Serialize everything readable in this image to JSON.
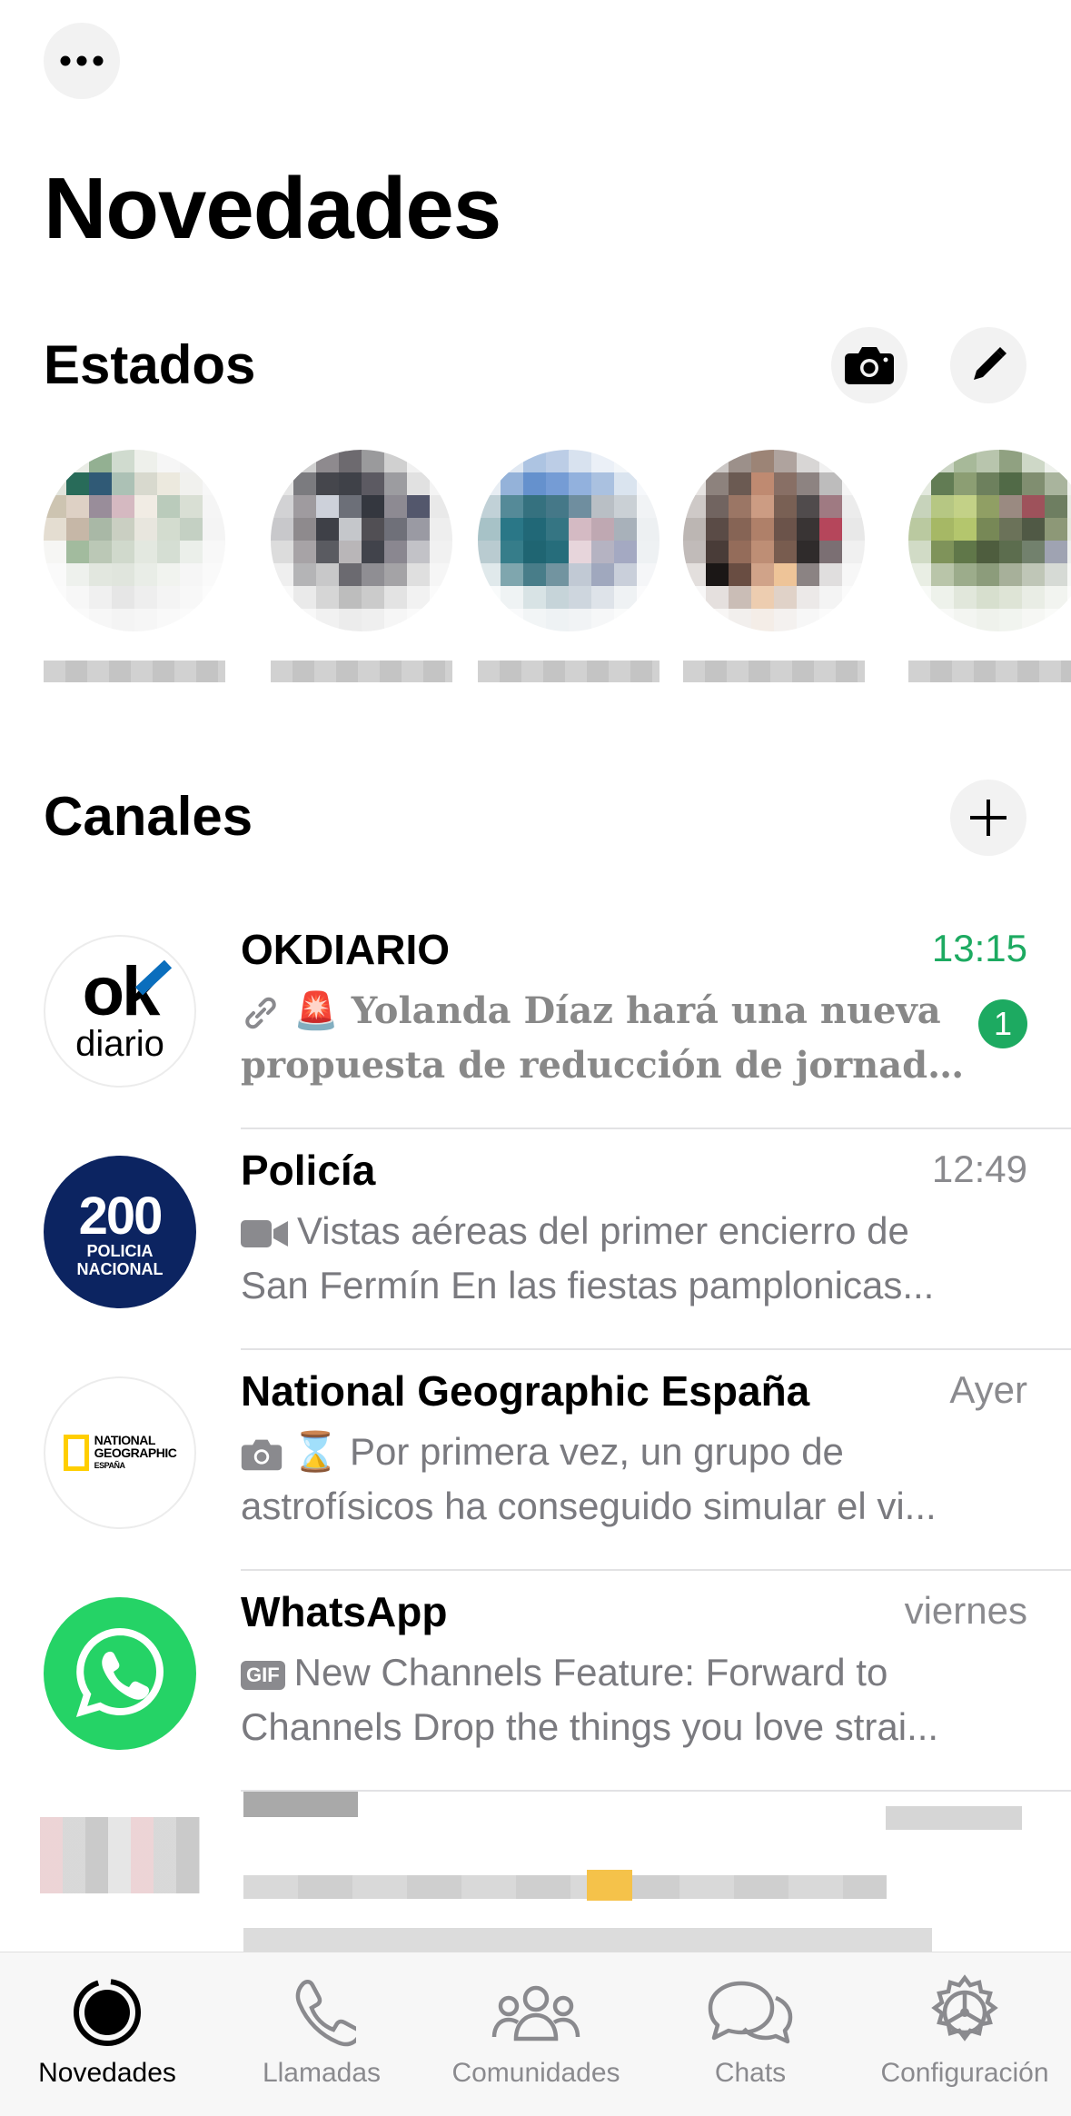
{
  "header": {
    "title": "Novedades"
  },
  "statuses": {
    "title": "Estados",
    "avatars": [
      {
        "colors": [
          "#f4f4f2",
          "#e9ece4",
          "#8fb28e",
          "#cfdccd",
          "#eef0ea",
          "#f6f6f6",
          "#f2f2f2",
          "#f8f8f8",
          "#e2e4db",
          "#1f6e58",
          "#2a5b7c",
          "#a9c2b4",
          "#d8d9cc",
          "#ece9dc",
          "#f1f1ee",
          "#f7f7f7",
          "#cfc4ae",
          "#e0d1c2",
          "#9b8c9c",
          "#d9b8c1",
          "#f2ece3",
          "#b8ccb9",
          "#d8dfd2",
          "#f5f5f5",
          "#e5ddcf",
          "#c8b7a4",
          "#a7b9a4",
          "#c9cfc0",
          "#e8e6dd",
          "#d2dccd",
          "#c3d1c1",
          "#f4f4f4",
          "#f6f6f4",
          "#9fbc9a",
          "#b9c9b4",
          "#cfd9ca",
          "#e2e8df",
          "#d4dfd1",
          "#ebefe9",
          "#f8f8f8",
          "#fafafa",
          "#eef1ec",
          "#e1e7de",
          "#dfe5dc",
          "#e9ede6",
          "#f1f3ef",
          "#f6f6f6",
          "#fafafa",
          "#fbfbfb",
          "#f7f7f7",
          "#f0f0f0",
          "#e6e6e6",
          "#eeeeee",
          "#f4f4f4",
          "#f8f8f8",
          "#fcfcfc",
          "#fcfcfc",
          "#fafafa",
          "#f7f7f7",
          "#f4f4f4",
          "#f6f6f6",
          "#f9f9f9",
          "#fbfbfb",
          "#fdfdfd"
        ]
      },
      {
        "colors": [
          "#f3f3f3",
          "#cfcfcf",
          "#8e8a8f",
          "#6d6a70",
          "#9a9a9c",
          "#d0d0d0",
          "#f1f1f1",
          "#f8f8f8",
          "#e5e5e5",
          "#7b7b80",
          "#45464d",
          "#3f4149",
          "#5c5a63",
          "#9c9ca1",
          "#e1e1e1",
          "#f4f4f4",
          "#d2d2d4",
          "#a09b9f",
          "#ccd1dc",
          "#6b6f7a",
          "#343740",
          "#8d8a93",
          "#525770",
          "#e9e9e9",
          "#c8c8cb",
          "#8e8a8d",
          "#3e4048",
          "#c5c7cc",
          "#514f55",
          "#6f707a",
          "#9a9aa5",
          "#eeeeee",
          "#dcdcdc",
          "#a7a3a6",
          "#5a5b62",
          "#b9b6b8",
          "#41434c",
          "#8a8791",
          "#c2c2c8",
          "#f1f1f1",
          "#efefef",
          "#b4b4b6",
          "#c8c8c9",
          "#6b6a71",
          "#8f8e94",
          "#a4a3a7",
          "#dfdfdf",
          "#f6f6f6",
          "#f9f9f9",
          "#eaeaea",
          "#d6d6d6",
          "#bdbdbd",
          "#cbcbcb",
          "#e3e3e3",
          "#f2f2f2",
          "#fbfbfb",
          "#fdfdfd",
          "#f8f8f8",
          "#f1f1f1",
          "#ececec",
          "#efefef",
          "#f6f6f6",
          "#fafafa",
          "#fdfdfd"
        ]
      },
      {
        "colors": [
          "#f5f7fb",
          "#dfe8f4",
          "#a9c4e8",
          "#b9cdeb",
          "#d6e2f2",
          "#eaf0f8",
          "#f3f6fa",
          "#fafbfd",
          "#e6edf4",
          "#8fb3e0",
          "#5e92d8",
          "#6f9de0",
          "#8db2e5",
          "#a6c1e6",
          "#d9e4f1",
          "#f6f8fb",
          "#bfd2d8",
          "#4e8c9c",
          "#2d7384",
          "#3e7a8c",
          "#6b8fa3",
          "#b8bfc6",
          "#c9d0d6",
          "#f1f3f5",
          "#a3c3c9",
          "#1f7a8c",
          "#176a7c",
          "#2c7788",
          "#d8b9c4",
          "#c2a7b3",
          "#a7b1bc",
          "#edf0f2",
          "#b6ccd2",
          "#2c7f8f",
          "#156777",
          "#1c6f80",
          "#e9d4db",
          "#b5b3c4",
          "#a3a9c6",
          "#eef1f4",
          "#dfe9ec",
          "#7aa7b1",
          "#417f8d",
          "#6d95a3",
          "#c0c9d6",
          "#9fa8c2",
          "#c8cfdc",
          "#f5f6f8",
          "#f9fbfb",
          "#eef3f4",
          "#d6e3e6",
          "#c4d4da",
          "#cdd6e0",
          "#dde3ea",
          "#eff2f5",
          "#fbfbfc",
          "#fdfdfd",
          "#f9fafb",
          "#f2f5f6",
          "#eef2f4",
          "#f1f3f5",
          "#f6f7f8",
          "#fafbfb",
          "#fdfdfd"
        ]
      },
      {
        "colors": [
          "#f4f3f2",
          "#cbc7c5",
          "#9e9088",
          "#a08373",
          "#b1a39d",
          "#d8d6d5",
          "#f1f1f1",
          "#f8f8f8",
          "#e6e3e1",
          "#8f827c",
          "#6e5950",
          "#c7886b",
          "#8c6e62",
          "#8e8380",
          "#bdbcbc",
          "#f5f5f5",
          "#cfc9c6",
          "#73645f",
          "#a07561",
          "#d39b7d",
          "#7d5f51",
          "#514b4c",
          "#a47882",
          "#ececec",
          "#bdb6b2",
          "#5c4b45",
          "#8b6351",
          "#b67e64",
          "#6e5248",
          "#3a3434",
          "#c4425a",
          "#e8e8e8",
          "#c2bbb8",
          "#4b3c37",
          "#9a6b55",
          "#c58d6f",
          "#7c5b4c",
          "#2f2b2b",
          "#7d6f73",
          "#f0f0f0",
          "#e3dfdd",
          "#1c1716",
          "#6d4c3f",
          "#d6a283",
          "#f4c38f",
          "#8c8383",
          "#e0dede",
          "#f7f7f7",
          "#f8f7f7",
          "#e6e0dd",
          "#ccbdb4",
          "#f2ccaa",
          "#e2d2c6",
          "#ece9e8",
          "#f4f4f4",
          "#fbfbfb",
          "#fdfdfd",
          "#f8f6f5",
          "#f3efec",
          "#f5ede6",
          "#f4f1ef",
          "#f7f7f7",
          "#fbfbfb",
          "#fdfdfd"
        ]
      },
      {
        "colors": [
          "#f3f5f0",
          "#cad6c1",
          "#a5ba95",
          "#b7c6a9",
          "#8ea27c",
          "#cdd9c4",
          "#eef1eb",
          "#f8f9f7",
          "#e2e9dc",
          "#5f7d4f",
          "#8a9f6d",
          "#6b8158",
          "#4e6b42",
          "#7e8f6c",
          "#a8b59a",
          "#f0f2ee",
          "#c6d4b8",
          "#b5c979",
          "#c2d27b",
          "#8fa05b",
          "#9c8a7f",
          "#a84f5a",
          "#6c7f5d",
          "#e8ece4",
          "#b9ca9a",
          "#a4ba58",
          "#b3c85f",
          "#75894f",
          "#6a7355",
          "#4f5a42",
          "#8c9972",
          "#e6eadf",
          "#d0dcc3",
          "#7d9452",
          "#5d7842",
          "#4c5e3a",
          "#5a6e49",
          "#70826a",
          "#9ea3b5",
          "#eef0ee",
          "#e9eee3",
          "#b8c6a5",
          "#9aad86",
          "#8a9d76",
          "#a6b197",
          "#bec6b5",
          "#d5dad4",
          "#f6f7f5",
          "#f8faf7",
          "#eef2ea",
          "#e0e7d9",
          "#d6dfcc",
          "#dde4d4",
          "#e9ede4",
          "#f2f4ef",
          "#fbfbfa",
          "#fcfdfc",
          "#f8f9f7",
          "#f3f5f1",
          "#eff2eb",
          "#f1f4ee",
          "#f6f7f4",
          "#fafbf9",
          "#fdfdfd"
        ]
      }
    ]
  },
  "channels": {
    "title": "Canales",
    "items": [
      {
        "name": "OKDIARIO",
        "time": "13:15",
        "time_color": "#1daa61",
        "unread": "1",
        "preview_line1": "🚨 Yolanda Díaz hará una nueva",
        "preview_line2": "propuesta de reducción de jornada e...",
        "preview_icon": "link-icon",
        "logo_text_top": "ok",
        "logo_text_bottom": "diario"
      },
      {
        "name": "Policía",
        "time": "12:49",
        "preview_line1": "Vistas aéreas del primer encierro de",
        "preview_line2": "San Fermín  En las fiestas pamplonicas...",
        "preview_icon": "video-icon",
        "logo_number": "200",
        "logo_line1": "POLICIA",
        "logo_line2": "NACIONAL"
      },
      {
        "name": "National Geographic España",
        "time": "Ayer",
        "preview_line1": "⌛ Por primera vez, un grupo de",
        "preview_line2": "astrofísicos ha conseguido simular el vi...",
        "preview_icon": "camera-icon",
        "logo_line1": "NATIONAL",
        "logo_line2": "GEOGRAPHIC",
        "logo_line3": "ESPAÑA"
      },
      {
        "name": "WhatsApp",
        "time": "viernes",
        "preview_line1": "New Channels Feature: Forward to",
        "preview_line2": "Channels Drop the things you love strai...",
        "preview_icon": "gif-icon",
        "gif_label": "GIF"
      }
    ]
  },
  "tabbar": {
    "tabs": [
      {
        "label": "Novedades",
        "icon": "updates-icon",
        "active": true
      },
      {
        "label": "Llamadas",
        "icon": "phone-icon",
        "active": false
      },
      {
        "label": "Comunidades",
        "icon": "communities-icon",
        "active": false
      },
      {
        "label": "Chats",
        "icon": "chats-icon",
        "active": false
      },
      {
        "label": "Configuración",
        "icon": "settings-icon",
        "active": false
      }
    ]
  },
  "colors": {
    "accent_green": "#1daa61",
    "whatsapp_green": "#25d366",
    "policia_navy": "#0c2461",
    "natgeo_yellow": "#ffce00"
  }
}
